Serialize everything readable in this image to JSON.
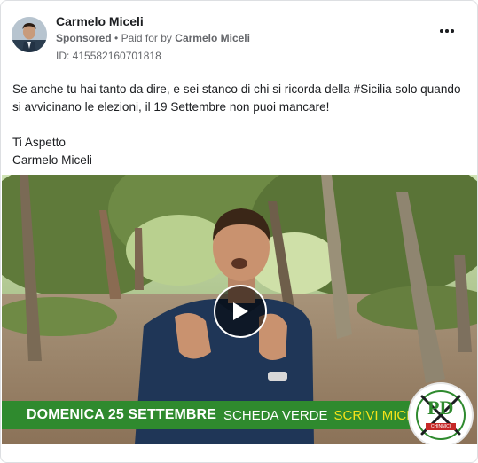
{
  "post": {
    "page_name": "Carmelo Miceli",
    "sponsored_label": "Sponsored",
    "separator": "•",
    "paid_for_prefix": "Paid for by",
    "paid_for_name": "Carmelo Miceli",
    "ad_id": "ID: 415582160701818",
    "menu_icon": "more-horizontal-icon"
  },
  "body": {
    "paragraph_1": "Se anche tu hai tanto da dire, e sei stanco di chi si ricorda della #Sicilia solo quando si avvicinano le elezioni, il 19 Settembre non puoi mancare!",
    "line_2": "Ti Aspetto",
    "line_3": "Carmelo Miceli"
  },
  "video": {
    "play_icon": "play-icon",
    "banner": {
      "date_text": "DOMENICA 25 SETTEMBRE",
      "ballot_text": "SCHEDA VERDE",
      "write_text": "SCRIVI MICELI"
    },
    "logo": {
      "party_letters": "PD",
      "ribbon_text": "CHINNICI"
    }
  },
  "colors": {
    "banner_green": "#2f8a2e",
    "highlight_yellow": "#f4e21a",
    "meta_gray": "#65676b"
  }
}
